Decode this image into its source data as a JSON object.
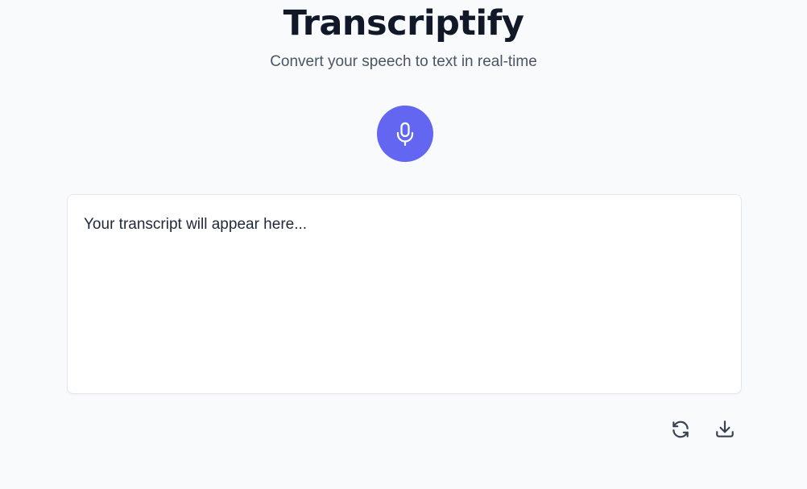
{
  "header": {
    "title": "Transcriptify",
    "subtitle": "Convert your speech to text in real-time"
  },
  "mic": {
    "icon": "microphone-icon",
    "color": "#6366f1"
  },
  "transcript": {
    "placeholder": "Your transcript will appear here..."
  },
  "actions": [
    {
      "icon": "refresh-icon"
    },
    {
      "icon": "download-icon"
    }
  ],
  "colors": {
    "background": "#f8fafc",
    "accent": "#6366f1",
    "title": "#111827",
    "subtitle": "#4b5563"
  }
}
